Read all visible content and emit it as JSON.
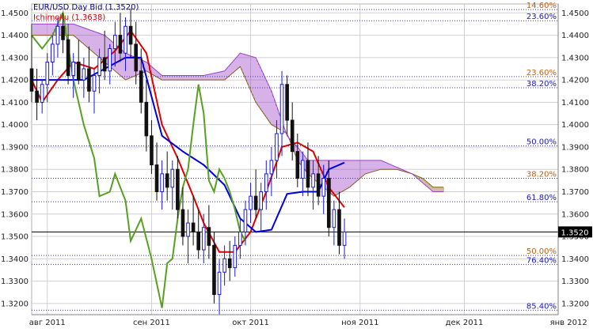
{
  "chart_data": {
    "type": "candlestick",
    "symbol_label": "EUR/USD Day Bid (1.3520)",
    "indicator_label": "Ichimoku (1.3638)",
    "current_price_label": "1.3520",
    "current_price": 1.352,
    "ylim": [
      1.315,
      1.454
    ],
    "xlim": [
      0,
      101
    ],
    "y_ticks": [
      {
        "value": 1.45,
        "label": "1.4500"
      },
      {
        "value": 1.44,
        "label": "1.4400"
      },
      {
        "value": 1.43,
        "label": "1.4300"
      },
      {
        "value": 1.42,
        "label": "1.4200"
      },
      {
        "value": 1.41,
        "label": "1.4100"
      },
      {
        "value": 1.4,
        "label": "1.4000"
      },
      {
        "value": 1.39,
        "label": "1.3900"
      },
      {
        "value": 1.38,
        "label": "1.3800"
      },
      {
        "value": 1.37,
        "label": "1.3700"
      },
      {
        "value": 1.36,
        "label": "1.3600"
      },
      {
        "value": 1.35,
        "label": "1.3500"
      },
      {
        "value": 1.34,
        "label": "1.3400"
      },
      {
        "value": 1.33,
        "label": "1.3300"
      },
      {
        "value": 1.32,
        "label": "1.3200"
      }
    ],
    "x_ticks": [
      {
        "x": 3,
        "label": "авг 2011"
      },
      {
        "x": 23,
        "label": "сен 2011"
      },
      {
        "x": 42,
        "label": "окт 2011"
      },
      {
        "x": 63,
        "label": "ноя 2011"
      },
      {
        "x": 83,
        "label": "дек 2011"
      },
      {
        "x": 103,
        "label": "янв 2012"
      }
    ],
    "fib_levels": [
      {
        "value": 1.4515,
        "label": "14.60%",
        "color": "#b8621b"
      },
      {
        "value": 1.4465,
        "label": "23.60%",
        "color": "#1a1ab0"
      },
      {
        "value": 1.4215,
        "label": "23.60%",
        "color": "#b8621b"
      },
      {
        "value": 1.4165,
        "label": "38.20%",
        "color": "#1a1ab0"
      },
      {
        "value": 1.3905,
        "label": "50.00%",
        "color": "#1a1ab0"
      },
      {
        "value": 1.376,
        "label": "38.20%",
        "color": "#b8621b"
      },
      {
        "value": 1.3655,
        "label": "61.80%",
        "color": "#1a1ab0"
      },
      {
        "value": 1.3415,
        "label": "50.00%",
        "color": "#b8621b"
      },
      {
        "value": 1.3375,
        "label": "76.40%",
        "color": "#1a1ab0"
      },
      {
        "value": 1.317,
        "label": "85.40%",
        "color": "#1a1ab0"
      }
    ],
    "candles": [
      {
        "x": 0,
        "o": 1.425,
        "h": 1.445,
        "l": 1.41,
        "c": 1.415
      },
      {
        "x": 1,
        "o": 1.415,
        "h": 1.425,
        "l": 1.402,
        "c": 1.41
      },
      {
        "x": 2,
        "o": 1.41,
        "h": 1.42,
        "l": 1.405,
        "c": 1.418
      },
      {
        "x": 3,
        "o": 1.418,
        "h": 1.432,
        "l": 1.41,
        "c": 1.428
      },
      {
        "x": 4,
        "o": 1.428,
        "h": 1.44,
        "l": 1.422,
        "c": 1.436
      },
      {
        "x": 5,
        "o": 1.436,
        "h": 1.448,
        "l": 1.43,
        "c": 1.444
      },
      {
        "x": 6,
        "o": 1.444,
        "h": 1.45,
        "l": 1.432,
        "c": 1.438
      },
      {
        "x": 7,
        "o": 1.438,
        "h": 1.445,
        "l": 1.418,
        "c": 1.422
      },
      {
        "x": 8,
        "o": 1.422,
        "h": 1.432,
        "l": 1.412,
        "c": 1.428
      },
      {
        "x": 9,
        "o": 1.428,
        "h": 1.438,
        "l": 1.418,
        "c": 1.42
      },
      {
        "x": 10,
        "o": 1.42,
        "h": 1.43,
        "l": 1.412,
        "c": 1.425
      },
      {
        "x": 11,
        "o": 1.425,
        "h": 1.435,
        "l": 1.41,
        "c": 1.415
      },
      {
        "x": 12,
        "o": 1.415,
        "h": 1.425,
        "l": 1.405,
        "c": 1.422
      },
      {
        "x": 13,
        "o": 1.422,
        "h": 1.434,
        "l": 1.414,
        "c": 1.43
      },
      {
        "x": 14,
        "o": 1.43,
        "h": 1.442,
        "l": 1.42,
        "c": 1.424
      },
      {
        "x": 15,
        "o": 1.424,
        "h": 1.436,
        "l": 1.418,
        "c": 1.434
      },
      {
        "x": 16,
        "o": 1.434,
        "h": 1.446,
        "l": 1.426,
        "c": 1.44
      },
      {
        "x": 17,
        "o": 1.44,
        "h": 1.45,
        "l": 1.428,
        "c": 1.432
      },
      {
        "x": 18,
        "o": 1.432,
        "h": 1.448,
        "l": 1.424,
        "c": 1.444
      },
      {
        "x": 19,
        "o": 1.444,
        "h": 1.452,
        "l": 1.43,
        "c": 1.436
      },
      {
        "x": 20,
        "o": 1.436,
        "h": 1.446,
        "l": 1.418,
        "c": 1.424
      },
      {
        "x": 21,
        "o": 1.424,
        "h": 1.434,
        "l": 1.405,
        "c": 1.41
      },
      {
        "x": 22,
        "o": 1.41,
        "h": 1.42,
        "l": 1.388,
        "c": 1.395
      },
      {
        "x": 23,
        "o": 1.395,
        "h": 1.402,
        "l": 1.378,
        "c": 1.382
      },
      {
        "x": 24,
        "o": 1.382,
        "h": 1.392,
        "l": 1.366,
        "c": 1.37
      },
      {
        "x": 25,
        "o": 1.37,
        "h": 1.384,
        "l": 1.362,
        "c": 1.378
      },
      {
        "x": 26,
        "o": 1.378,
        "h": 1.388,
        "l": 1.366,
        "c": 1.372
      },
      {
        "x": 27,
        "o": 1.372,
        "h": 1.384,
        "l": 1.362,
        "c": 1.38
      },
      {
        "x": 28,
        "o": 1.38,
        "h": 1.386,
        "l": 1.358,
        "c": 1.362
      },
      {
        "x": 29,
        "o": 1.362,
        "h": 1.372,
        "l": 1.346,
        "c": 1.35
      },
      {
        "x": 30,
        "o": 1.35,
        "h": 1.362,
        "l": 1.338,
        "c": 1.356
      },
      {
        "x": 31,
        "o": 1.356,
        "h": 1.368,
        "l": 1.346,
        "c": 1.352
      },
      {
        "x": 32,
        "o": 1.352,
        "h": 1.362,
        "l": 1.34,
        "c": 1.344
      },
      {
        "x": 33,
        "o": 1.344,
        "h": 1.36,
        "l": 1.338,
        "c": 1.354
      },
      {
        "x": 34,
        "o": 1.354,
        "h": 1.364,
        "l": 1.34,
        "c": 1.346
      },
      {
        "x": 35,
        "o": 1.346,
        "h": 1.352,
        "l": 1.32,
        "c": 1.324
      },
      {
        "x": 36,
        "o": 1.324,
        "h": 1.34,
        "l": 1.315,
        "c": 1.334
      },
      {
        "x": 37,
        "o": 1.334,
        "h": 1.346,
        "l": 1.328,
        "c": 1.34
      },
      {
        "x": 38,
        "o": 1.34,
        "h": 1.348,
        "l": 1.33,
        "c": 1.336
      },
      {
        "x": 39,
        "o": 1.336,
        "h": 1.35,
        "l": 1.332,
        "c": 1.346
      },
      {
        "x": 40,
        "o": 1.346,
        "h": 1.358,
        "l": 1.34,
        "c": 1.352
      },
      {
        "x": 41,
        "o": 1.352,
        "h": 1.366,
        "l": 1.346,
        "c": 1.362
      },
      {
        "x": 42,
        "o": 1.362,
        "h": 1.374,
        "l": 1.356,
        "c": 1.368
      },
      {
        "x": 43,
        "o": 1.368,
        "h": 1.38,
        "l": 1.358,
        "c": 1.362
      },
      {
        "x": 44,
        "o": 1.362,
        "h": 1.374,
        "l": 1.352,
        "c": 1.37
      },
      {
        "x": 45,
        "o": 1.37,
        "h": 1.384,
        "l": 1.362,
        "c": 1.378
      },
      {
        "x": 46,
        "o": 1.378,
        "h": 1.39,
        "l": 1.368,
        "c": 1.384
      },
      {
        "x": 47,
        "o": 1.384,
        "h": 1.402,
        "l": 1.376,
        "c": 1.396
      },
      {
        "x": 48,
        "o": 1.396,
        "h": 1.424,
        "l": 1.386,
        "c": 1.418
      },
      {
        "x": 49,
        "o": 1.418,
        "h": 1.422,
        "l": 1.396,
        "c": 1.402
      },
      {
        "x": 50,
        "o": 1.402,
        "h": 1.41,
        "l": 1.384,
        "c": 1.388
      },
      {
        "x": 51,
        "o": 1.388,
        "h": 1.396,
        "l": 1.372,
        "c": 1.376
      },
      {
        "x": 52,
        "o": 1.376,
        "h": 1.388,
        "l": 1.368,
        "c": 1.384
      },
      {
        "x": 53,
        "o": 1.384,
        "h": 1.392,
        "l": 1.368,
        "c": 1.372
      },
      {
        "x": 54,
        "o": 1.372,
        "h": 1.384,
        "l": 1.362,
        "c": 1.378
      },
      {
        "x": 55,
        "o": 1.378,
        "h": 1.386,
        "l": 1.364,
        "c": 1.368
      },
      {
        "x": 56,
        "o": 1.368,
        "h": 1.382,
        "l": 1.36,
        "c": 1.376
      },
      {
        "x": 57,
        "o": 1.376,
        "h": 1.384,
        "l": 1.35,
        "c": 1.354
      },
      {
        "x": 58,
        "o": 1.354,
        "h": 1.366,
        "l": 1.346,
        "c": 1.362
      },
      {
        "x": 59,
        "o": 1.362,
        "h": 1.37,
        "l": 1.342,
        "c": 1.346
      },
      {
        "x": 60,
        "o": 1.346,
        "h": 1.358,
        "l": 1.34,
        "c": 1.352
      }
    ],
    "series": [
      {
        "name": "tenkan",
        "color": "#dd0000",
        "points": [
          [
            0,
            1.42
          ],
          [
            2,
            1.41
          ],
          [
            5,
            1.42
          ],
          [
            8,
            1.428
          ],
          [
            12,
            1.425
          ],
          [
            16,
            1.433
          ],
          [
            19,
            1.442
          ],
          [
            22,
            1.432
          ],
          [
            25,
            1.4
          ],
          [
            28,
            1.385
          ],
          [
            31,
            1.368
          ],
          [
            33,
            1.356
          ],
          [
            36,
            1.343
          ],
          [
            39,
            1.343
          ],
          [
            42,
            1.352
          ],
          [
            45,
            1.37
          ],
          [
            48,
            1.39
          ],
          [
            51,
            1.392
          ],
          [
            54,
            1.388
          ],
          [
            57,
            1.372
          ],
          [
            60,
            1.363
          ]
        ]
      },
      {
        "name": "kijun",
        "color": "#0000dd",
        "points": [
          [
            0,
            1.42
          ],
          [
            10,
            1.42
          ],
          [
            14,
            1.425
          ],
          [
            18,
            1.43
          ],
          [
            21,
            1.43
          ],
          [
            25,
            1.395
          ],
          [
            29,
            1.388
          ],
          [
            33,
            1.382
          ],
          [
            37,
            1.373
          ],
          [
            40,
            1.358
          ],
          [
            43,
            1.352
          ],
          [
            46,
            1.353
          ],
          [
            49,
            1.369
          ],
          [
            52,
            1.37
          ],
          [
            55,
            1.37
          ],
          [
            57,
            1.38
          ],
          [
            60,
            1.383
          ]
        ]
      },
      {
        "name": "chikou",
        "color": "#58a020",
        "points": [
          [
            0,
            1.44
          ],
          [
            2,
            1.434
          ],
          [
            4,
            1.44
          ],
          [
            6,
            1.45
          ],
          [
            8,
            1.42
          ],
          [
            10,
            1.4
          ],
          [
            12,
            1.385
          ],
          [
            13,
            1.368
          ],
          [
            15,
            1.37
          ],
          [
            16,
            1.378
          ],
          [
            18,
            1.366
          ],
          [
            19,
            1.348
          ],
          [
            21,
            1.358
          ],
          [
            23,
            1.34
          ],
          [
            25,
            1.318
          ],
          [
            26,
            1.338
          ],
          [
            27,
            1.34
          ],
          [
            28,
            1.358
          ],
          [
            29,
            1.372
          ],
          [
            30,
            1.38
          ],
          [
            31,
            1.4
          ],
          [
            32,
            1.418
          ],
          [
            33,
            1.405
          ],
          [
            34,
            1.375
          ],
          [
            35,
            1.37
          ],
          [
            36,
            1.38
          ],
          [
            37,
            1.376
          ],
          [
            38,
            1.37
          ],
          [
            39,
            1.362
          ],
          [
            40,
            1.352
          ],
          [
            41,
            1.348
          ]
        ]
      }
    ],
    "cloud_a": [
      [
        0,
        1.44
      ],
      [
        8,
        1.44
      ],
      [
        14,
        1.428
      ],
      [
        18,
        1.42
      ],
      [
        22,
        1.424
      ],
      [
        25,
        1.42
      ],
      [
        30,
        1.42
      ],
      [
        33,
        1.42
      ],
      [
        37,
        1.42
      ],
      [
        40,
        1.426
      ],
      [
        43,
        1.41
      ],
      [
        46,
        1.4
      ],
      [
        49,
        1.396
      ],
      [
        51,
        1.384
      ],
      [
        53,
        1.378
      ],
      [
        55,
        1.374
      ],
      [
        58,
        1.368
      ],
      [
        61,
        1.372
      ],
      [
        64,
        1.378
      ],
      [
        67,
        1.38
      ],
      [
        70,
        1.38
      ],
      [
        73,
        1.378
      ],
      [
        75,
        1.376
      ],
      [
        77,
        1.372
      ],
      [
        79,
        1.372
      ]
    ],
    "cloud_b": [
      [
        0,
        1.445
      ],
      [
        8,
        1.445
      ],
      [
        14,
        1.44
      ],
      [
        18,
        1.432
      ],
      [
        22,
        1.428
      ],
      [
        25,
        1.422
      ],
      [
        30,
        1.422
      ],
      [
        33,
        1.422
      ],
      [
        37,
        1.424
      ],
      [
        40,
        1.432
      ],
      [
        43,
        1.43
      ],
      [
        46,
        1.415
      ],
      [
        49,
        1.395
      ],
      [
        51,
        1.39
      ],
      [
        53,
        1.384
      ],
      [
        55,
        1.384
      ],
      [
        58,
        1.384
      ],
      [
        61,
        1.384
      ],
      [
        64,
        1.384
      ],
      [
        67,
        1.384
      ],
      [
        70,
        1.381
      ],
      [
        73,
        1.378
      ],
      [
        75,
        1.374
      ],
      [
        77,
        1.37
      ],
      [
        79,
        1.37
      ]
    ],
    "colors": {
      "bull": "#1a1ad8",
      "bear": "#111111",
      "cloud_bull": "#9a3fc8",
      "cloud_bear": "#8b5a1e",
      "fib_line": "#3a3aa0",
      "grid": "#d0d0d0",
      "current_line": "#000000",
      "legend_symbol": "#000080",
      "legend_indicator": "#cc0000"
    }
  }
}
